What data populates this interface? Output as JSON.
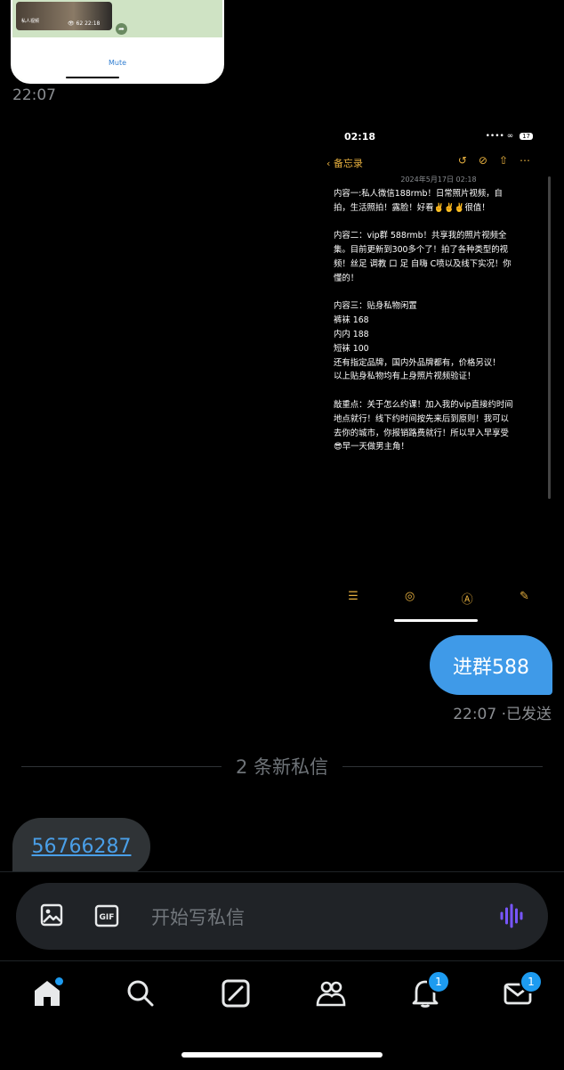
{
  "top_preview": {
    "time_label": "22:07",
    "video_meta": "👁 62 22:18",
    "video_label": "私人视频",
    "mute_label": "Mute"
  },
  "notes_screenshot": {
    "status_time": "02:18",
    "signal": "•••• ∞",
    "battery": "17",
    "back_label": "‹ 备忘录",
    "toolbar_icons": "↺⊘⇧⋯",
    "date": "2024年5月17日 02:18",
    "body": "内容一:私人微信188rmb！日常照片视频，自\n拍，生活照拍！露脸！好看✌️✌️✌️很值！\n\n内容二：vip群 588rmb！共享我的照片视频全\n集。目前更新到300多个了！拍了各种类型的视\n频！丝足 调教 口 足 自嗨 C喷以及线下实况！你\n懂的！\n\n内容三：贴身私物闲置\n裤袜 168\n内内 188\n短袜 100\n还有指定品牌，国内外品牌都有，价格另议！\n以上贴身私物均有上身照片视频验证！\n\n敲重点：关于怎么约课！加入我的vip直接约时间\n地点就行！线下约时间按先来后到原则！我可以\n去你的城市，你报销路费就行！所以早入早享受\n😎早一天做男主角！",
    "bottom_icons": [
      "☰",
      "◎",
      "Ⓐ",
      "✎"
    ]
  },
  "sent_message": {
    "text": "进群588",
    "meta": "22:07 ·已发送"
  },
  "divider_text": "2 条新私信",
  "received_message": {
    "link_text": "56766287"
  },
  "composer": {
    "placeholder": "开始写私信",
    "gif_label": "GIF"
  },
  "tabbar": {
    "notifications_badge": "1",
    "messages_badge": "1"
  },
  "colors": {
    "accent": "#1d9bf0",
    "sent_bubble": "#3f9ae8",
    "received_bubble": "#2f3336",
    "notes_accent": "#e7b03f",
    "voice_icon": "#7856ff"
  }
}
